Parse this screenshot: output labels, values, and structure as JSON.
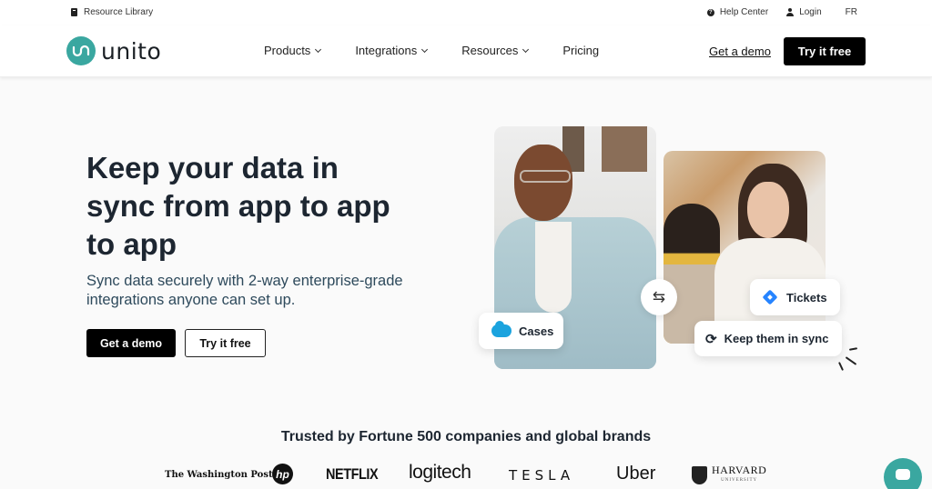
{
  "utility_bar": {
    "resource_library": "Resource Library",
    "help_center": "Help Center",
    "login": "Login",
    "language": "FR"
  },
  "nav": {
    "logo_text": "unito",
    "links": [
      {
        "label": "Products",
        "has_dropdown": true
      },
      {
        "label": "Integrations",
        "has_dropdown": true
      },
      {
        "label": "Resources",
        "has_dropdown": true
      },
      {
        "label": "Pricing",
        "has_dropdown": false
      }
    ],
    "get_demo": "Get a demo",
    "try_free": "Try it free"
  },
  "hero": {
    "title": "Keep your data in sync from app to app to app",
    "subtitle": "Sync data securely with 2-way enterprise-grade integrations anyone can set up.",
    "primary_cta": "Get a demo",
    "secondary_cta": "Try it free"
  },
  "illustration": {
    "chip_cases": "Cases",
    "chip_tickets": "Tickets",
    "chip_sync": "Keep them in sync",
    "sync_arrows": "⇆",
    "sync_icon": "⟳"
  },
  "trusted": {
    "title": "Trusted by Fortune 500 companies and global brands",
    "brands": [
      "The Washington Post",
      "hp",
      "NETFLIX",
      "logitech",
      "TESLA",
      "Uber",
      "HARVARD",
      "UNIVERSITY"
    ]
  },
  "colors": {
    "brand_teal": "#3aa7a0",
    "cta_black": "#000000",
    "salesforce_blue": "#1ba3de",
    "jira_blue": "#2684ff"
  }
}
